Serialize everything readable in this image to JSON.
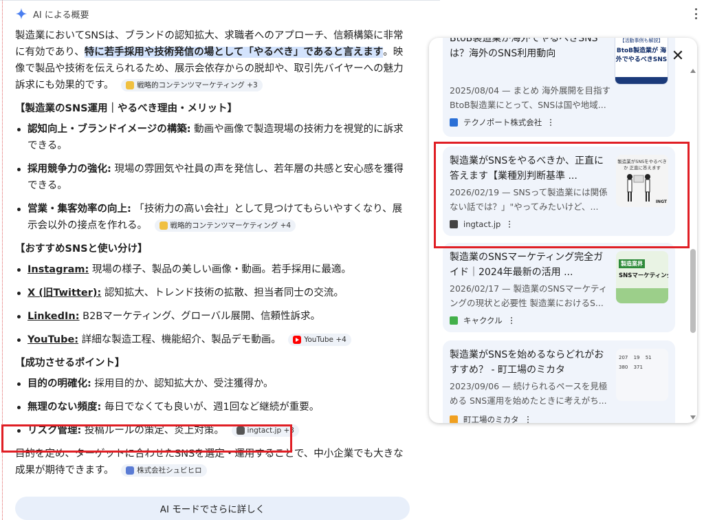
{
  "header": {
    "title": "AI による概要"
  },
  "intro": {
    "before": "製造業においてSNSは、ブランドの認知拡大、求職者へのアプローチ、信頼構築に非常に有効であり、",
    "highlight": "特に若手採用や技術発信の場として「やるべき」であると言えます",
    "after": "。映像で製品や技術を伝えられるため、展示会依存からの脱却や、取引先バイヤーへの魅力訴求にも効果的です。",
    "chip": "戦略的コンテンツマーケティング +3"
  },
  "sections": [
    {
      "heading": "【製造業のSNS運用｜やるべき理由・メリット】",
      "items": [
        {
          "term": "認知向上・ブランドイメージの構築:",
          "text": " 動画や画像で製造現場の技術力を視覚的に訴求できる。",
          "chip": ""
        },
        {
          "term": "採用競争力の強化:",
          "text": " 現場の雰囲気や社員の声を発信し、若年層の共感と安心感を獲得できる。",
          "chip": ""
        },
        {
          "term": "営業・集客効率の向上:",
          "text": " 「技術力の高い会社」として見つけてもらいやすくなり、展示会以外の接点を作れる。",
          "chip": "戦略的コンテンツマーケティング +4"
        }
      ]
    },
    {
      "heading": "【おすすめSNSと使い分け】",
      "items": [
        {
          "term": "Instagram:",
          "text": " 現場の様子、製品の美しい画像・動画。若手採用に最適。",
          "chip": ""
        },
        {
          "term": "X (旧Twitter):",
          "text": " 認知拡大、トレンド技術の拡散、担当者同士の交流。",
          "chip": ""
        },
        {
          "term": "LinkedIn:",
          "text": " B2Bマーケティング、グローバル展開、信頼性訴求。",
          "chip": ""
        },
        {
          "term": "YouTube:",
          "text": " 詳細な製造工程、機能紹介、製品デモ動画。",
          "chip": "YouTube +4"
        }
      ]
    },
    {
      "heading": "【成功させるポイント】",
      "items": [
        {
          "term": "目的の明確化:",
          "text": " 採用目的か、認知拡大か、受注獲得か。",
          "chip": ""
        },
        {
          "term": "無理のない頻度:",
          "text": " 毎日でなくても良いが、週1回など継続が重要。",
          "chip": ""
        },
        {
          "term": "リスク管理:",
          "text": " 投稿ルールの策定、炎上対策。",
          "chip": "ingtact.jp +3"
        }
      ]
    }
  ],
  "conclusion": {
    "text": "目的を定め、ターゲットに合わせたSNSを選定・運用することで、中小企業でも大きな成果が期待できます。",
    "chip": "株式会社シュビヒロ"
  },
  "more_button": "AI モードでさらに詳しく",
  "panel": {
    "close_label": "✕",
    "cards": [
      {
        "title": "BtoB製造業が海外でやるべきSNSは？海外のSNS利用動向",
        "snippet": "2025/08/04 — まとめ 海外展開を目指すBtoB製造業にとって、SNSは国や地域...",
        "source": "テクノポート株式会社",
        "thumb_text": "BtoB製造業が 海外でやるべきSNS",
        "thumb_tag": "【活動事例も解説】"
      },
      {
        "title": "製造業がSNSをやるべきか、正直に答えます【業種別判断基準 ...",
        "snippet": "2026/02/19 — SNSって製造業には関係ない話では？」\"やってみたいけど、...",
        "source": "ingtact.jp",
        "thumb_text": "製造業がSNSをやるべきか 正直に答えます",
        "thumb_tag": "INGT"
      },
      {
        "title": "製造業のSNSマーケティング完全ガイド｜2024年最新の活用 ...",
        "snippet": "2026/02/17 — 製造業のSNSマーケティングの現状と必要性 製造業におけるS...",
        "source": "キャククル",
        "thumb_text": "SNSマーケティング",
        "thumb_tag": "製造業界"
      },
      {
        "title": "製造業がSNSを始めるならどれがおすすめ？ - 町工場のミカタ",
        "snippet": "2023/09/06 — 続けられるペースを見極める SNS運用を始めたときに考えがち...",
        "source": "町工場のミカタ",
        "thumb_text": "207 19 51 380 371",
        "thumb_tag": ""
      }
    ]
  }
}
